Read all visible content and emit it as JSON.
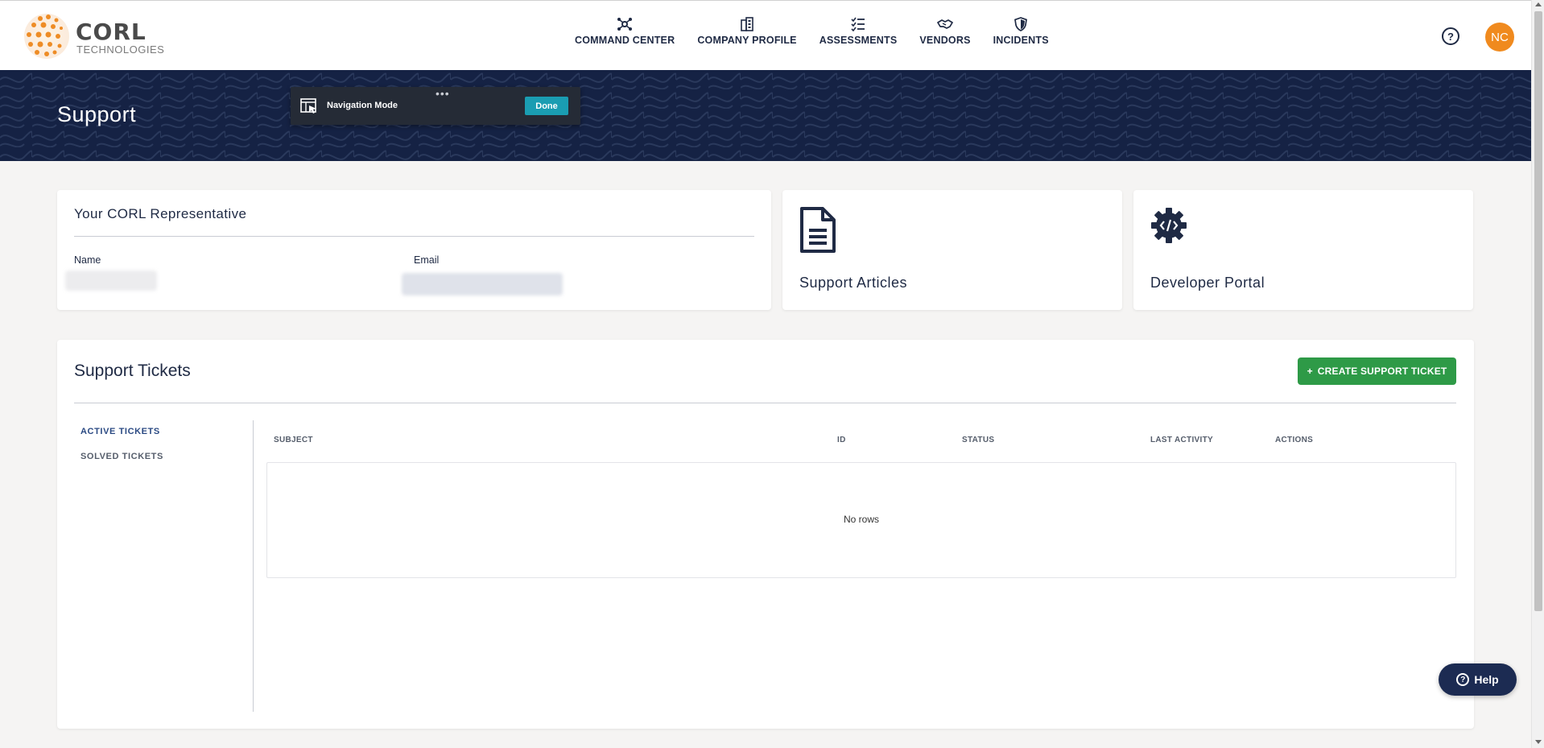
{
  "brand": {
    "name": "CORL",
    "subtitle": "TECHNOLOGIES",
    "logo_color": "#f08a1e"
  },
  "nav": {
    "items": [
      {
        "label": "COMMAND CENTER",
        "icon": "network-icon"
      },
      {
        "label": "COMPANY PROFILE",
        "icon": "building-icon"
      },
      {
        "label": "ASSESSMENTS",
        "icon": "checklist-icon"
      },
      {
        "label": "VENDORS",
        "icon": "handshake-icon"
      },
      {
        "label": "INCIDENTS",
        "icon": "shield-icon"
      }
    ]
  },
  "header": {
    "help_icon": "?",
    "avatar_initials": "NC"
  },
  "banner": {
    "title": "Support"
  },
  "navigation_mode": {
    "label": "Navigation Mode",
    "done_label": "Done",
    "dots": "•••"
  },
  "representative": {
    "title": "Your CORL Representative",
    "name_label": "Name",
    "email_label": "Email"
  },
  "links": {
    "articles_label": "Support Articles",
    "developer_label": "Developer Portal"
  },
  "tickets": {
    "title": "Support Tickets",
    "create_label": "CREATE SUPPORT TICKET",
    "create_icon": "+",
    "tabs": [
      "ACTIVE TICKETS",
      "SOLVED TICKETS"
    ],
    "columns": [
      "SUBJECT",
      "ID",
      "STATUS",
      "LAST ACTIVITY",
      "ACTIONS"
    ],
    "empty_text": "No rows"
  },
  "help_fab": {
    "label": "Help",
    "icon": "?"
  },
  "colors": {
    "navy": "#1f2a44",
    "banner": "#152244",
    "green": "#2e9a47",
    "teal": "#1a9db2",
    "orange": "#f08a1e"
  }
}
